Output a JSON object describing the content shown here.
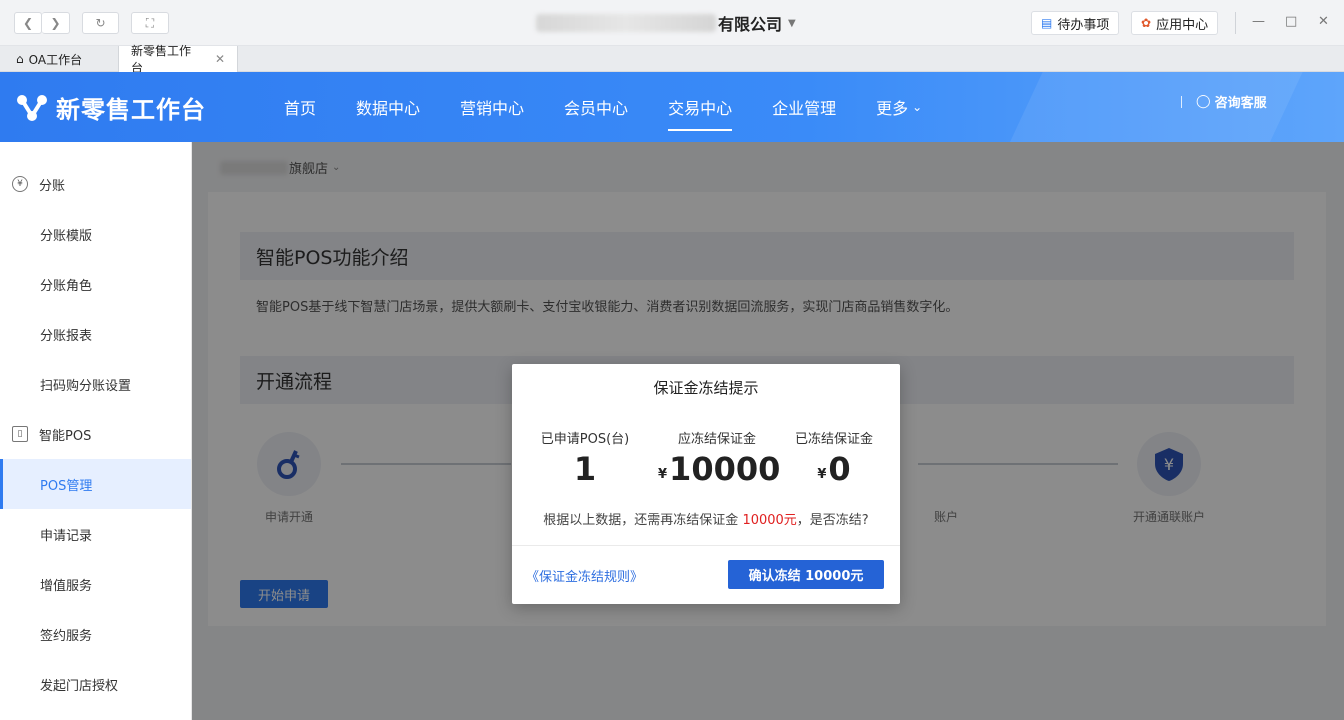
{
  "window": {
    "company_suffix": "有限公司",
    "todo_label": "待办事项",
    "apps_label": "应用中心"
  },
  "tabs": [
    {
      "label": "OA工作台"
    },
    {
      "label": "新零售工作台"
    }
  ],
  "header": {
    "logo_text": "新零售工作台",
    "nav": [
      {
        "label": "首页"
      },
      {
        "label": "数据中心"
      },
      {
        "label": "营销中心"
      },
      {
        "label": "会员中心"
      },
      {
        "label": "交易中心"
      },
      {
        "label": "企业管理"
      },
      {
        "label": "更多"
      }
    ],
    "active_nav": "交易中心",
    "support_label": "咨询客服"
  },
  "sidebar": {
    "groups": [
      {
        "label": "分账",
        "icon": "yuan-circle-icon",
        "items": [
          {
            "label": "分账模版"
          },
          {
            "label": "分账角色"
          },
          {
            "label": "分账报表"
          },
          {
            "label": "扫码购分账设置"
          }
        ]
      },
      {
        "label": "智能POS",
        "icon": "pos-device-icon",
        "items": [
          {
            "label": "POS管理"
          },
          {
            "label": "申请记录"
          },
          {
            "label": "增值服务"
          },
          {
            "label": "签约服务"
          },
          {
            "label": "发起门店授权"
          }
        ]
      }
    ],
    "active_item": "POS管理"
  },
  "main": {
    "store_suffix": "旗舰店",
    "intro_title": "智能POS功能介绍",
    "intro_text": "智能POS基于线下智慧门店场景，提供大额刷卡、支付宝收银能力、消费者识别数据回流服务，实现门店商品销售数字化。",
    "flow_title": "开通流程",
    "steps": [
      {
        "label": "申请开通",
        "icon": "key-icon"
      },
      {
        "label": "账户",
        "icon": "account-icon"
      },
      {
        "label": "开通通联账户",
        "icon": "shield-yuan-icon"
      }
    ],
    "start_button": "开始申请"
  },
  "modal": {
    "title": "保证金冻结提示",
    "stats": [
      {
        "label": "已申请POS(台)",
        "value": "1",
        "currency": ""
      },
      {
        "label": "应冻结保证金",
        "value": "10000",
        "currency": "¥"
      },
      {
        "label": "已冻结保证金",
        "value": "0",
        "currency": "¥"
      }
    ],
    "note_prefix": "根据以上数据，还需再冻结保证金",
    "note_amount": "10000元",
    "note_suffix": "，是否冻结?",
    "rules_link": "《保证金冻结规则》",
    "confirm_button": "确认冻结 10000元"
  },
  "colors": {
    "brand_blue": "#2f7bf0",
    "alert_red": "#e02020"
  }
}
